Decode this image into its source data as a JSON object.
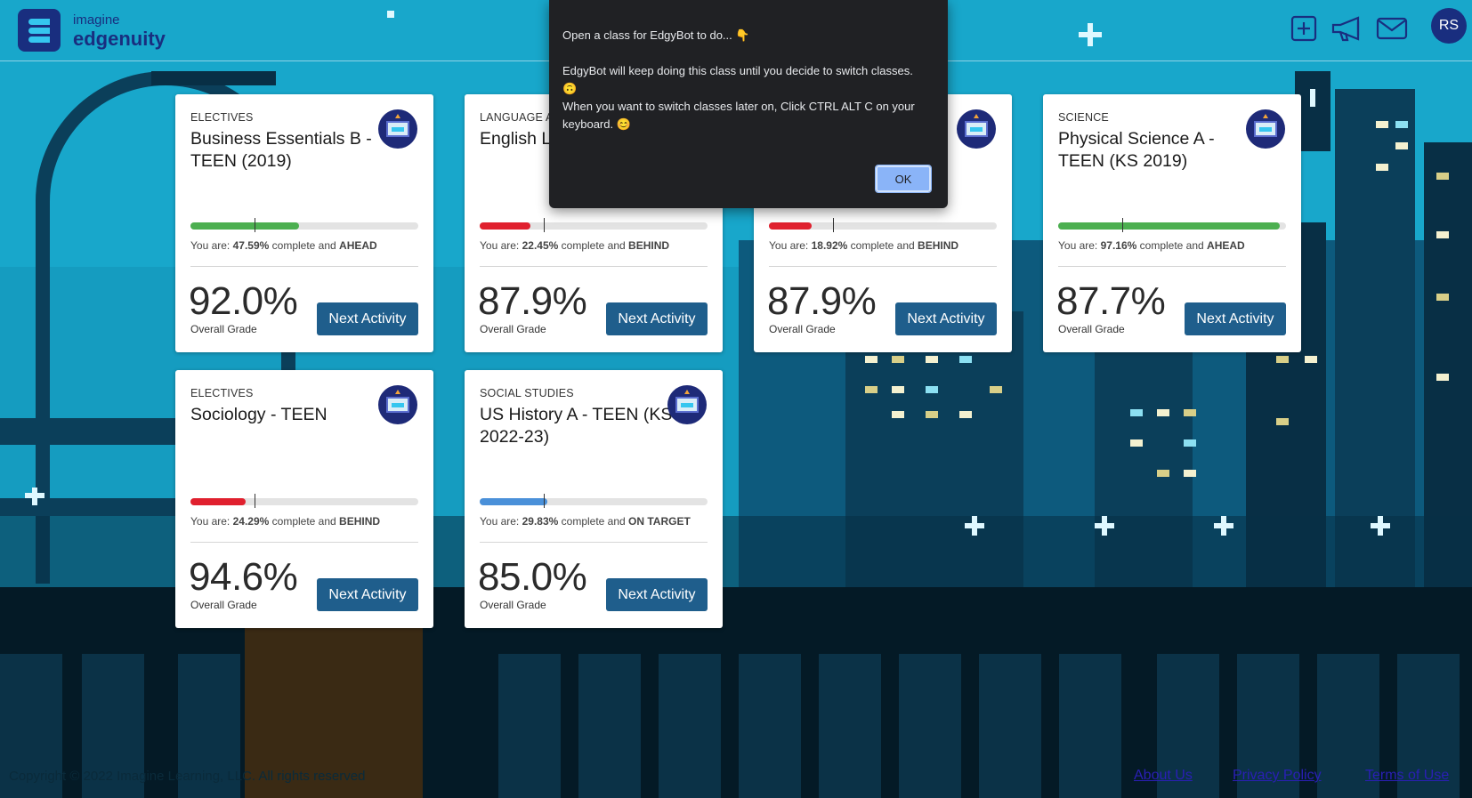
{
  "header": {
    "brand_top": "imagine",
    "brand_main": "edgenuity",
    "icons": [
      "add-icon",
      "megaphone-icon",
      "mail-icon"
    ],
    "avatar_initials": "RS"
  },
  "dialog": {
    "line1": "Open a class for EdgyBot to do... 👇",
    "line2": "EdgyBot will keep doing this class until you decide to switch classes. 🙃",
    "line3": "When you want to switch classes later on, Click CTRL ALT C on your keyboard. 😊",
    "ok_label": "OK"
  },
  "status_prefix": "You are: ",
  "status_mid": " complete and ",
  "grade_label": "Overall Grade",
  "next_label": "Next Activity",
  "cards": [
    {
      "category": "ELECTIVES",
      "title": "Business Essentials B - TEEN (2019)",
      "pct": "47.59%",
      "progress": 0.4759,
      "target": 0.28,
      "status": "AHEAD",
      "color": "#4caf50",
      "grade": "92.0%"
    },
    {
      "category": "LANGUAGE A",
      "title": "English L 11 A - TE",
      "pct": "22.45%",
      "progress": 0.2245,
      "target": 0.28,
      "status": "BEHIND",
      "color": "#e0202e",
      "grade": "87.9%"
    },
    {
      "category": "",
      "title": "",
      "pct": "18.92%",
      "progress": 0.1892,
      "target": 0.28,
      "status": "BEHIND",
      "color": "#e0202e",
      "grade": "87.9%"
    },
    {
      "category": "SCIENCE",
      "title": "Physical Science A - TEEN (KS 2019)",
      "pct": "97.16%",
      "progress": 0.9716,
      "target": 0.28,
      "status": "AHEAD",
      "color": "#4caf50",
      "grade": "87.7%"
    },
    {
      "category": "ELECTIVES",
      "title": "Sociology - TEEN",
      "pct": "24.29%",
      "progress": 0.2429,
      "target": 0.28,
      "status": "BEHIND",
      "color": "#e0202e",
      "grade": "94.6%"
    },
    {
      "category": "SOCIAL STUDIES",
      "title": "US History A - TEEN (KS 2022-23)",
      "pct": "29.83%",
      "progress": 0.2983,
      "target": 0.28,
      "status": "ON TARGET",
      "color": "#4a90d9",
      "grade": "85.0%"
    }
  ],
  "footer": {
    "copyright": "Copyright © 2022 Imagine Learning, LLC. All rights reserved",
    "about": "About Us",
    "privacy": "Privacy Policy",
    "terms": "Terms of Use"
  }
}
